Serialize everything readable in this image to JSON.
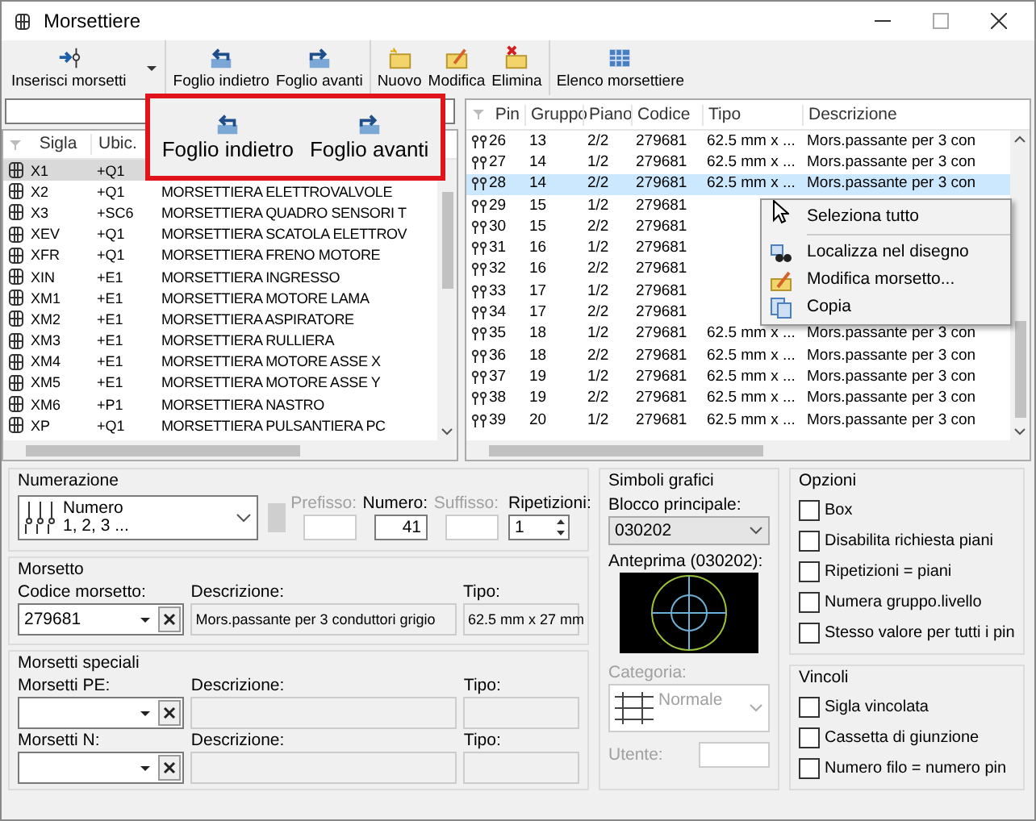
{
  "window": {
    "title": "Morsettiere"
  },
  "toolbar": [
    [
      {
        "label": "Inserisci morsetti",
        "dropdown": true
      }
    ],
    [
      {
        "label": "Foglio indietro",
        "dropdown": false
      },
      {
        "label": "Foglio avanti",
        "dropdown": false
      }
    ],
    [
      {
        "label": "Nuovo",
        "dropdown": false
      },
      {
        "label": "Modifica",
        "dropdown": false
      },
      {
        "label": "Elimina",
        "dropdown": false
      }
    ],
    [
      {
        "label": "Elenco morsettiere",
        "dropdown": false
      }
    ]
  ],
  "callout": {
    "buttons": [
      "Foglio indietro",
      "Foglio avanti"
    ]
  },
  "left_table": {
    "columns": [
      "Sigla",
      "Ubic."
    ],
    "rows": [
      {
        "sigla": "X1",
        "ubic": "+Q1",
        "selected": true
      },
      {
        "sigla": "X2",
        "ubic": "+Q1",
        "descrizione": "MORSETTIERA ELETTROVALVOLE",
        "selected": false
      },
      {
        "sigla": "X3",
        "ubic": "+SC6",
        "descrizione": "MORSETTIERA QUADRO SENSORI T",
        "selected": false
      },
      {
        "sigla": "XEV",
        "ubic": "+Q1",
        "descrizione": "MORSETTIERA SCATOLA ELETTROV",
        "selected": false
      },
      {
        "sigla": "XFR",
        "ubic": "+Q1",
        "descrizione": "MORSETTIERA FRENO MOTORE",
        "selected": false
      },
      {
        "sigla": "XIN",
        "ubic": "+E1",
        "descrizione": "MORSETTIERA INGRESSO",
        "selected": false
      },
      {
        "sigla": "XM1",
        "ubic": "+E1",
        "descrizione": "MORSETTIERA MOTORE LAMA",
        "selected": false
      },
      {
        "sigla": "XM2",
        "ubic": "+E1",
        "descrizione": "MORSETTIERA ASPIRATORE",
        "selected": false
      },
      {
        "sigla": "XM3",
        "ubic": "+E1",
        "descrizione": "MORSETTIERA RULLIERA",
        "selected": false
      },
      {
        "sigla": "XM4",
        "ubic": "+E1",
        "descrizione": "MORSETTIERA MOTORE ASSE X",
        "selected": false
      },
      {
        "sigla": "XM5",
        "ubic": "+E1",
        "descrizione": "MORSETTIERA MOTORE ASSE Y",
        "selected": false
      },
      {
        "sigla": "XM6",
        "ubic": "+P1",
        "descrizione": "MORSETTIERA NASTRO",
        "selected": false
      },
      {
        "sigla": "XP",
        "ubic": "+Q1",
        "descrizione": "MORSETTIERA PULSANTIERA PC",
        "selected": false
      }
    ]
  },
  "right_table": {
    "columns": [
      "Pin",
      "Gruppo",
      "Piano",
      "Codice",
      "Tipo",
      "Descrizione"
    ],
    "rows": [
      {
        "pin": "26",
        "gruppo": "13",
        "piano": "2/2",
        "codice": "279681",
        "tipo": "62.5 mm x ...",
        "descrizione": "Mors.passante per 3 con",
        "selected": false
      },
      {
        "pin": "27",
        "gruppo": "14",
        "piano": "1/2",
        "codice": "279681",
        "tipo": "62.5 mm x ...",
        "descrizione": "Mors.passante per 3 con",
        "selected": false
      },
      {
        "pin": "28",
        "gruppo": "14",
        "piano": "2/2",
        "codice": "279681",
        "tipo": "62.5 mm x ...",
        "descrizione": "Mors.passante per 3 con",
        "selected": true
      },
      {
        "pin": "29",
        "gruppo": "15",
        "piano": "1/2",
        "codice": "279681",
        "selected": false
      },
      {
        "pin": "30",
        "gruppo": "15",
        "piano": "2/2",
        "codice": "279681",
        "selected": false
      },
      {
        "pin": "31",
        "gruppo": "16",
        "piano": "1/2",
        "codice": "279681",
        "selected": false
      },
      {
        "pin": "32",
        "gruppo": "16",
        "piano": "2/2",
        "codice": "279681",
        "selected": false
      },
      {
        "pin": "33",
        "gruppo": "17",
        "piano": "1/2",
        "codice": "279681",
        "selected": false
      },
      {
        "pin": "34",
        "gruppo": "17",
        "piano": "2/2",
        "codice": "279681",
        "selected": false
      },
      {
        "pin": "35",
        "gruppo": "18",
        "piano": "1/2",
        "codice": "279681",
        "tipo": "62.5 mm x ...",
        "descrizione": "Mors.passante per 3 con",
        "selected": false
      },
      {
        "pin": "36",
        "gruppo": "18",
        "piano": "2/2",
        "codice": "279681",
        "tipo": "62.5 mm x ...",
        "descrizione": "Mors.passante per 3 con",
        "selected": false
      },
      {
        "pin": "37",
        "gruppo": "19",
        "piano": "1/2",
        "codice": "279681",
        "tipo": "62.5 mm x ...",
        "descrizione": "Mors.passante per 3 con",
        "selected": false
      },
      {
        "pin": "38",
        "gruppo": "19",
        "piano": "2/2",
        "codice": "279681",
        "tipo": "62.5 mm x ...",
        "descrizione": "Mors.passante per 3 con",
        "selected": false
      },
      {
        "pin": "39",
        "gruppo": "20",
        "piano": "1/2",
        "codice": "279681",
        "tipo": "62.5 mm x ...",
        "descrizione": "Mors.passante per 3 con",
        "selected": false
      }
    ]
  },
  "context_menu": [
    "Seleziona tutto",
    "Localizza nel disegno",
    "Modifica morsetto...",
    "Copia"
  ],
  "numerazione": {
    "title": "Numerazione",
    "scheme_name": "Numero",
    "scheme_example": "1, 2, 3 ...",
    "fields": [
      {
        "label": "Prefisso:",
        "disabled": true
      },
      {
        "label": "Numero:",
        "value": "41",
        "disabled": false
      },
      {
        "label": "Suffisso:",
        "disabled": true
      }
    ],
    "ripetizioni": {
      "label": "Ripetizioni:",
      "value": "1"
    }
  },
  "morsetto": {
    "title": "Morsetto",
    "codice_label": "Codice morsetto:",
    "codice": "279681",
    "descrizione_label": "Descrizione:",
    "descrizione": "Mors.passante per 3 conduttori grigio",
    "tipo_label": "Tipo:",
    "tipo": "62.5 mm x 27 mm"
  },
  "morsetti_speciali": {
    "title": "Morsetti speciali",
    "rows": [
      {
        "label": "Morsetti PE:",
        "descrizione_label": "Descrizione:",
        "tipo_label": "Tipo:"
      },
      {
        "label": "Morsetti N:",
        "descrizione_label": "Descrizione:",
        "tipo_label": "Tipo:"
      }
    ]
  },
  "simboli_grafici": {
    "title": "Simboli grafici",
    "blocco_label": "Blocco principale:",
    "blocco": "030202",
    "anteprima_label": "Anteprima (030202):",
    "categoria_label": "Categoria:",
    "categoria": "Normale",
    "utente_label": "Utente:",
    "disabled": true
  },
  "opzioni": {
    "title": "Opzioni",
    "items": [
      {
        "label": "Box",
        "checked": false
      },
      {
        "label": "Disabilita richiesta piani",
        "checked": false
      },
      {
        "label": "Ripetizioni = piani",
        "checked": false
      },
      {
        "label": "Numera gruppo.livello",
        "checked": false
      },
      {
        "label": "Stesso valore per tutti i pin",
        "checked": false
      }
    ]
  },
  "vincoli": {
    "title": "Vincoli",
    "items": [
      {
        "label": "Sigla vincolata",
        "checked": false
      },
      {
        "label": "Cassetta di giunzione",
        "checked": false
      },
      {
        "label": "Numero filo = numero pin",
        "checked": false
      }
    ]
  }
}
